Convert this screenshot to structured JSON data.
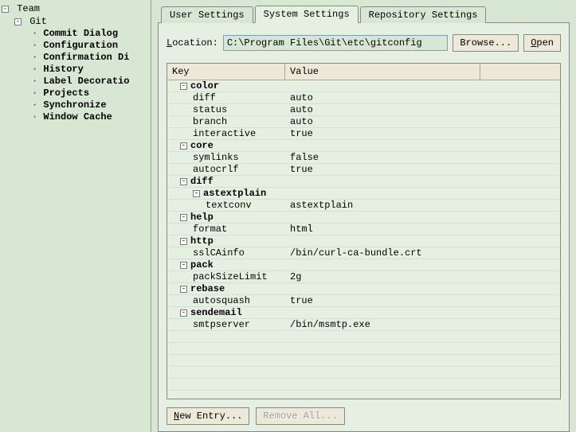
{
  "sidebar": {
    "root": {
      "label": "Team",
      "expanded": true
    },
    "children": [
      {
        "label": "Git",
        "expanded": true,
        "children": [
          {
            "label": "Commit Dialog"
          },
          {
            "label": "Configuration",
            "selected": true
          },
          {
            "label": "Confirmation Di"
          },
          {
            "label": "History"
          },
          {
            "label": "Label Decoratio"
          },
          {
            "label": "Projects"
          },
          {
            "label": "Synchronize"
          },
          {
            "label": "Window Cache"
          }
        ]
      }
    ]
  },
  "tabs": [
    {
      "label": "User Settings",
      "active": false
    },
    {
      "label": "System Settings",
      "active": true
    },
    {
      "label": "Repository Settings",
      "active": false
    }
  ],
  "location": {
    "label_pre": "L",
    "label_post": "ocation:",
    "value": "C:\\Program Files\\Git\\etc\\gitconfig",
    "browse": "Browse...",
    "open_pre": "O",
    "open_post": "pen"
  },
  "table": {
    "headers": {
      "key": "Key",
      "value": "Value"
    },
    "groups": [
      {
        "name": "color",
        "rows": [
          {
            "k": "diff",
            "v": "auto"
          },
          {
            "k": "status",
            "v": "auto"
          },
          {
            "k": "branch",
            "v": "auto"
          },
          {
            "k": "interactive",
            "v": "true"
          }
        ]
      },
      {
        "name": "core",
        "rows": [
          {
            "k": "symlinks",
            "v": "false"
          },
          {
            "k": "autocrlf",
            "v": "true"
          }
        ]
      },
      {
        "name": "diff",
        "subgroups": [
          {
            "name": "astextplain",
            "rows": [
              {
                "k": "textconv",
                "v": "astextplain"
              }
            ]
          }
        ]
      },
      {
        "name": "help",
        "rows": [
          {
            "k": "format",
            "v": "html"
          }
        ]
      },
      {
        "name": "http",
        "rows": [
          {
            "k": "sslCAinfo",
            "v": "/bin/curl-ca-bundle.crt"
          }
        ]
      },
      {
        "name": "pack",
        "rows": [
          {
            "k": "packSizeLimit",
            "v": "2g"
          }
        ]
      },
      {
        "name": "rebase",
        "rows": [
          {
            "k": "autosquash",
            "v": "true"
          }
        ]
      },
      {
        "name": "sendemail",
        "rows": [
          {
            "k": "smtpserver",
            "v": "/bin/msmtp.exe"
          }
        ]
      }
    ]
  },
  "buttons": {
    "new_entry_pre": "N",
    "new_entry_post": "ew Entry...",
    "remove_all": "Remove All..."
  }
}
